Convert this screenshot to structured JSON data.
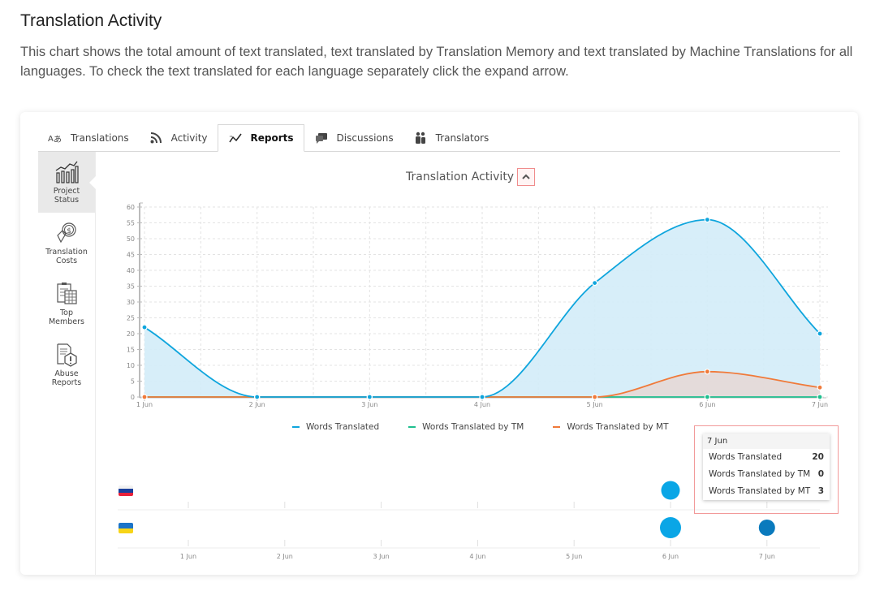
{
  "page": {
    "title": "Translation Activity",
    "description": "This chart shows the total amount of text translated, text translated by Translation Memory and text translated by Machine Translations for all languages. To check the text translated for each language separately click the expand arrow."
  },
  "tabs": [
    {
      "label": "Translations",
      "icon": "translate-icon",
      "active": false
    },
    {
      "label": "Activity",
      "icon": "rss-icon",
      "active": false
    },
    {
      "label": "Reports",
      "icon": "line-chart-icon",
      "active": true
    },
    {
      "label": "Discussions",
      "icon": "chat-bubbles-icon",
      "active": false
    },
    {
      "label": "Translators",
      "icon": "people-icon",
      "active": false
    }
  ],
  "sidebar": {
    "items": [
      {
        "label_line1": "Project",
        "label_line2": "Status",
        "icon": "bar-trend-icon",
        "active": true
      },
      {
        "label_line1": "Translation",
        "label_line2": "Costs",
        "icon": "dollar-hand-icon",
        "active": false
      },
      {
        "label_line1": "Top",
        "label_line2": "Members",
        "icon": "clipboard-table-icon",
        "active": false
      },
      {
        "label_line1": "Abuse",
        "label_line2": "Reports",
        "icon": "report-warning-icon",
        "active": false
      }
    ]
  },
  "chart_header": {
    "title": "Translation Activity",
    "expand_icon": "chevron-up-icon"
  },
  "colors": {
    "words_translated": "#0ea5dd",
    "words_tm": "#1fbf8f",
    "words_mt": "#f07a3a",
    "area_fill": "#d3ecf8",
    "mt_fill": "#e6d8d6",
    "bubble_light": "#0aa6e6",
    "bubble_dark": "#0a7abd",
    "highlight_border": "#f29a9a"
  },
  "chart_data": [
    {
      "type": "area",
      "title": "Translation Activity",
      "xlabel": "",
      "ylabel": "",
      "categories": [
        "1 Jun",
        "2 Jun",
        "3 Jun",
        "4 Jun",
        "5 Jun",
        "6 Jun",
        "7 Jun"
      ],
      "series": [
        {
          "name": "Words Translated",
          "values": [
            22,
            0,
            0,
            0,
            36,
            56,
            20
          ]
        },
        {
          "name": "Words Translated by TM",
          "values": [
            0,
            0,
            0,
            0,
            0,
            0,
            0
          ]
        },
        {
          "name": "Words Translated by MT",
          "values": [
            0,
            0,
            0,
            0,
            0,
            8,
            3
          ]
        }
      ],
      "ylim": [
        0,
        60
      ],
      "yticks": [
        0,
        5,
        10,
        15,
        20,
        25,
        30,
        35,
        40,
        45,
        50,
        55,
        60
      ],
      "grid": true,
      "legend": "bottom"
    },
    {
      "type": "scatter",
      "title": "",
      "categories": [
        "1 Jun",
        "2 Jun",
        "3 Jun",
        "4 Jun",
        "5 Jun",
        "6 Jun",
        "7 Jun"
      ],
      "rows": [
        {
          "language": "Russian",
          "flag": "ru-flag",
          "points": [
            {
              "x": "6 Jun",
              "size": "medium",
              "shade": "light"
            }
          ]
        },
        {
          "language": "Ukrainian",
          "flag": "ua-flag",
          "points": [
            {
              "x": "6 Jun",
              "size": "large",
              "shade": "light"
            },
            {
              "x": "7 Jun",
              "size": "small",
              "shade": "dark"
            }
          ]
        }
      ]
    }
  ],
  "tooltip": {
    "header": "7 Jun",
    "rows": [
      {
        "label": "Words Translated",
        "value": "20"
      },
      {
        "label": "Words Translated by TM",
        "value": "0"
      },
      {
        "label": "Words Translated by MT",
        "value": "3"
      }
    ]
  }
}
